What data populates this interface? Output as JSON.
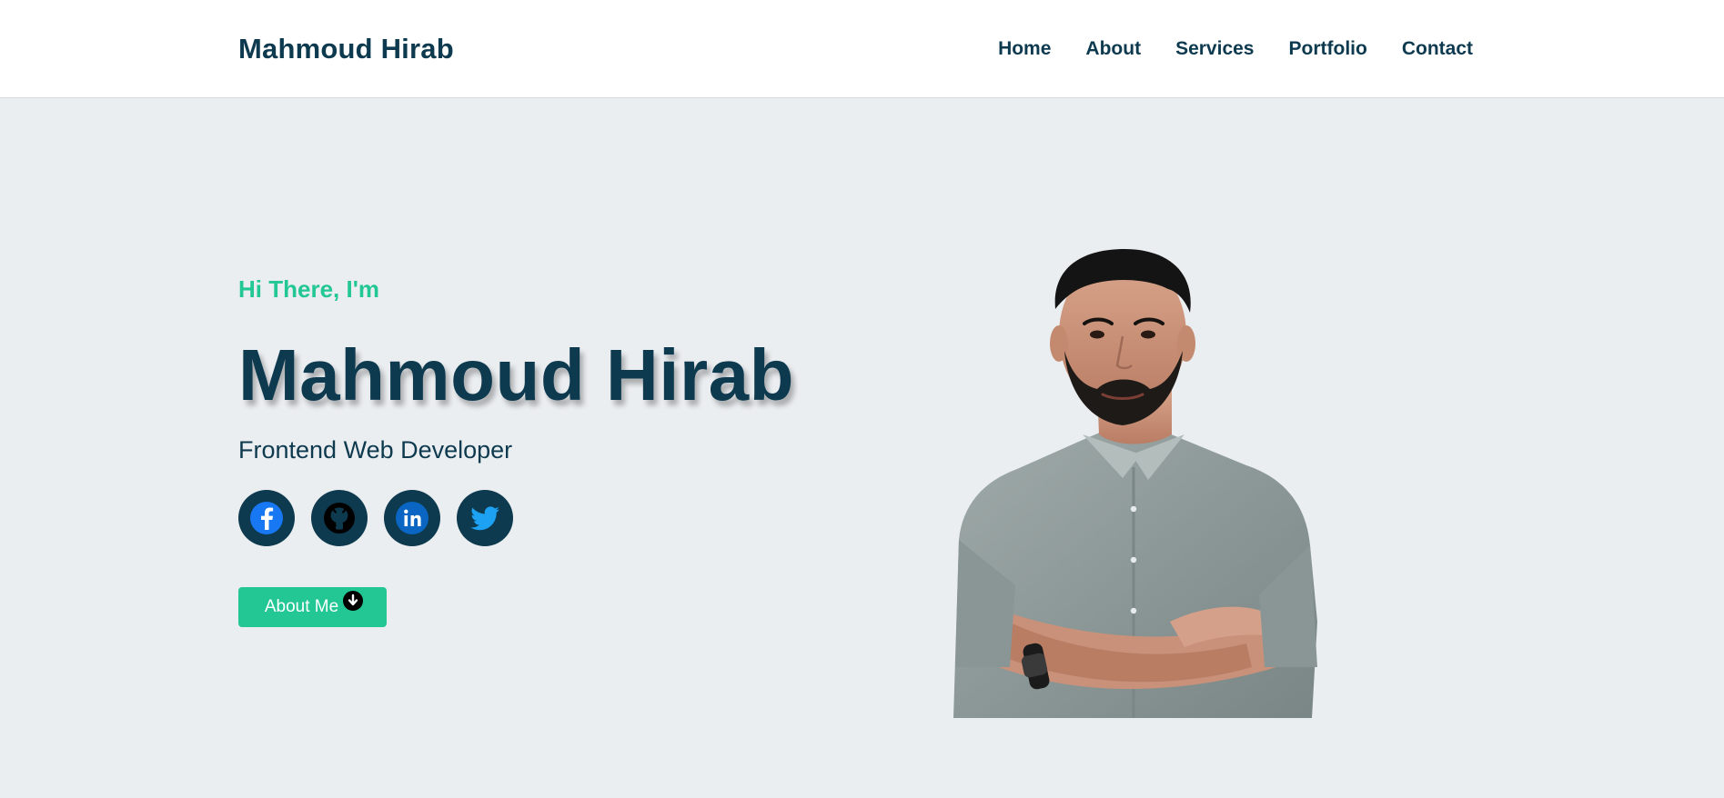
{
  "header": {
    "brand": "Mahmoud Hirab",
    "nav": [
      {
        "label": "Home"
      },
      {
        "label": "About"
      },
      {
        "label": "Services"
      },
      {
        "label": "Portfolio"
      },
      {
        "label": "Contact"
      }
    ]
  },
  "hero": {
    "greeting": "Hi There, I'm",
    "name": "Mahmoud Hirab",
    "role": "Frontend Web Developer",
    "socials": [
      {
        "icon": "facebook-icon"
      },
      {
        "icon": "github-icon"
      },
      {
        "icon": "linkedin-icon"
      },
      {
        "icon": "twitter-icon"
      }
    ],
    "cta_label": "About Me",
    "cta_icon": "arrow-down-circle-icon"
  },
  "colors": {
    "primary": "#0e3a4f",
    "accent": "#22c793",
    "background": "#ebeef1",
    "header_bg": "#ffffff"
  }
}
